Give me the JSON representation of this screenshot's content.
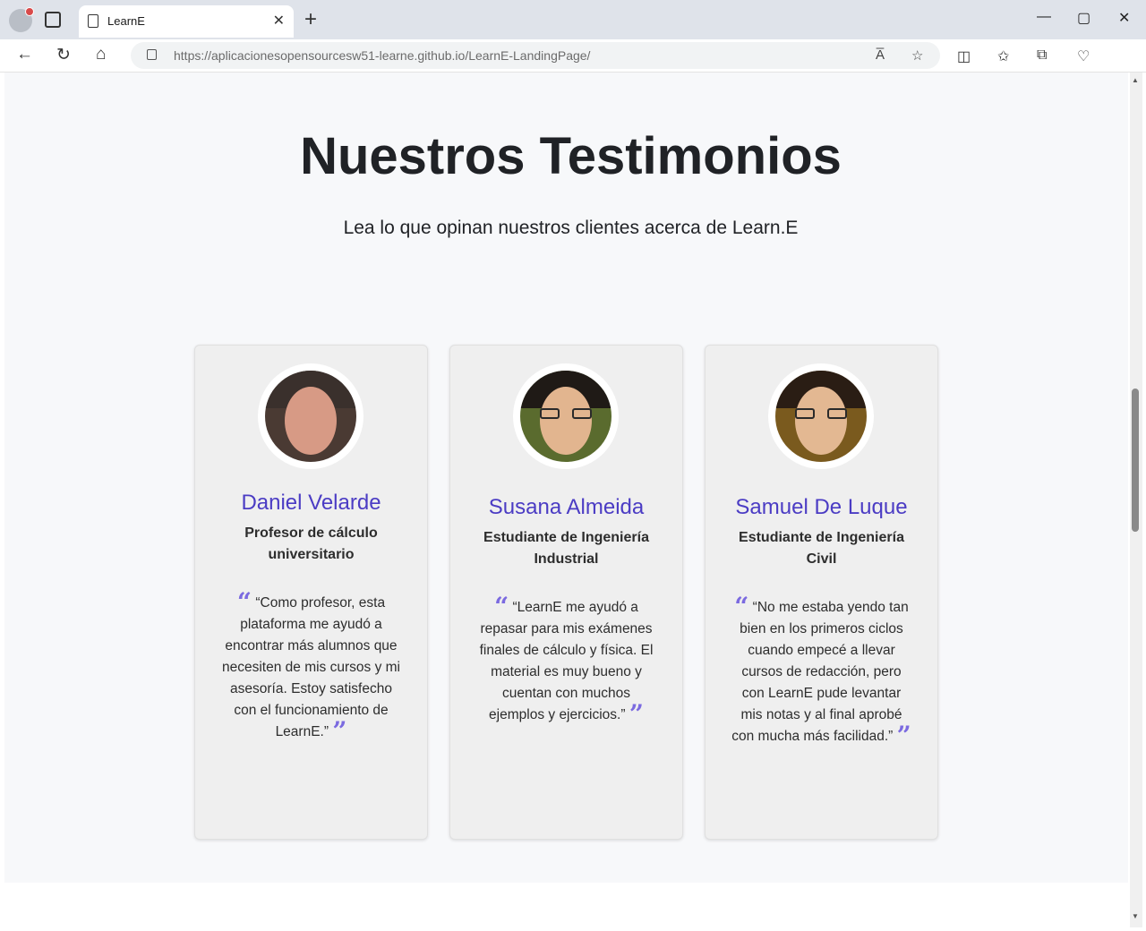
{
  "browser": {
    "tab_title": "LearnE",
    "tab_close": "✕",
    "new_tab": "+",
    "url_host": "https://aplicacionesopensourcesw51-learne.github.io",
    "url_path": "/LearnE-LandingPage/",
    "window_minimize": "—",
    "window_maximize": "▢",
    "window_close": "✕",
    "back": "←",
    "refresh": "↻",
    "home": "⌂",
    "read_aloud": "A̅",
    "favorite": "☆",
    "split": "◫",
    "favorites": "✩",
    "collections": "⧉",
    "health": "♡"
  },
  "section": {
    "title": "Nuestros Testimonios",
    "subtitle": "Lea lo que opinan nuestros clientes acerca de Learn.E"
  },
  "testimonials": [
    {
      "name": "Daniel Velarde",
      "role": "Profesor de cálculo universitario",
      "open_quote": "“",
      "quote": "“Como profesor, esta plataforma me ayudó a encontrar más alumnos que necesiten de mis cursos y mi asesoría. Estoy satisfecho con el funcionamiento de LearnE.”",
      "close_quote": "”"
    },
    {
      "name": "Susana Almeida",
      "role": "Estudiante de Ingeniería Industrial",
      "open_quote": "“",
      "quote": "“LearnE me ayudó a repasar para mis exámenes finales de cálculo y física. El material es muy bueno y cuentan con muchos ejemplos y ejercicios.”",
      "close_quote": "”"
    },
    {
      "name": "Samuel De Luque",
      "role": "Estudiante de Ingeniería Civil",
      "open_quote": "“",
      "quote": "“No me estaba yendo tan bien en los primeros ciclos cuando empecé a llevar cursos de redacción, pero con LearnE pude levantar mis notas y al final aprobé con mucha más facilidad.”",
      "close_quote": "”"
    }
  ],
  "colors": {
    "accent": "#4b3cc4",
    "quote_mark": "#7b6ae0",
    "card_bg": "#efefef",
    "section_bg": "#f7f8fa"
  }
}
